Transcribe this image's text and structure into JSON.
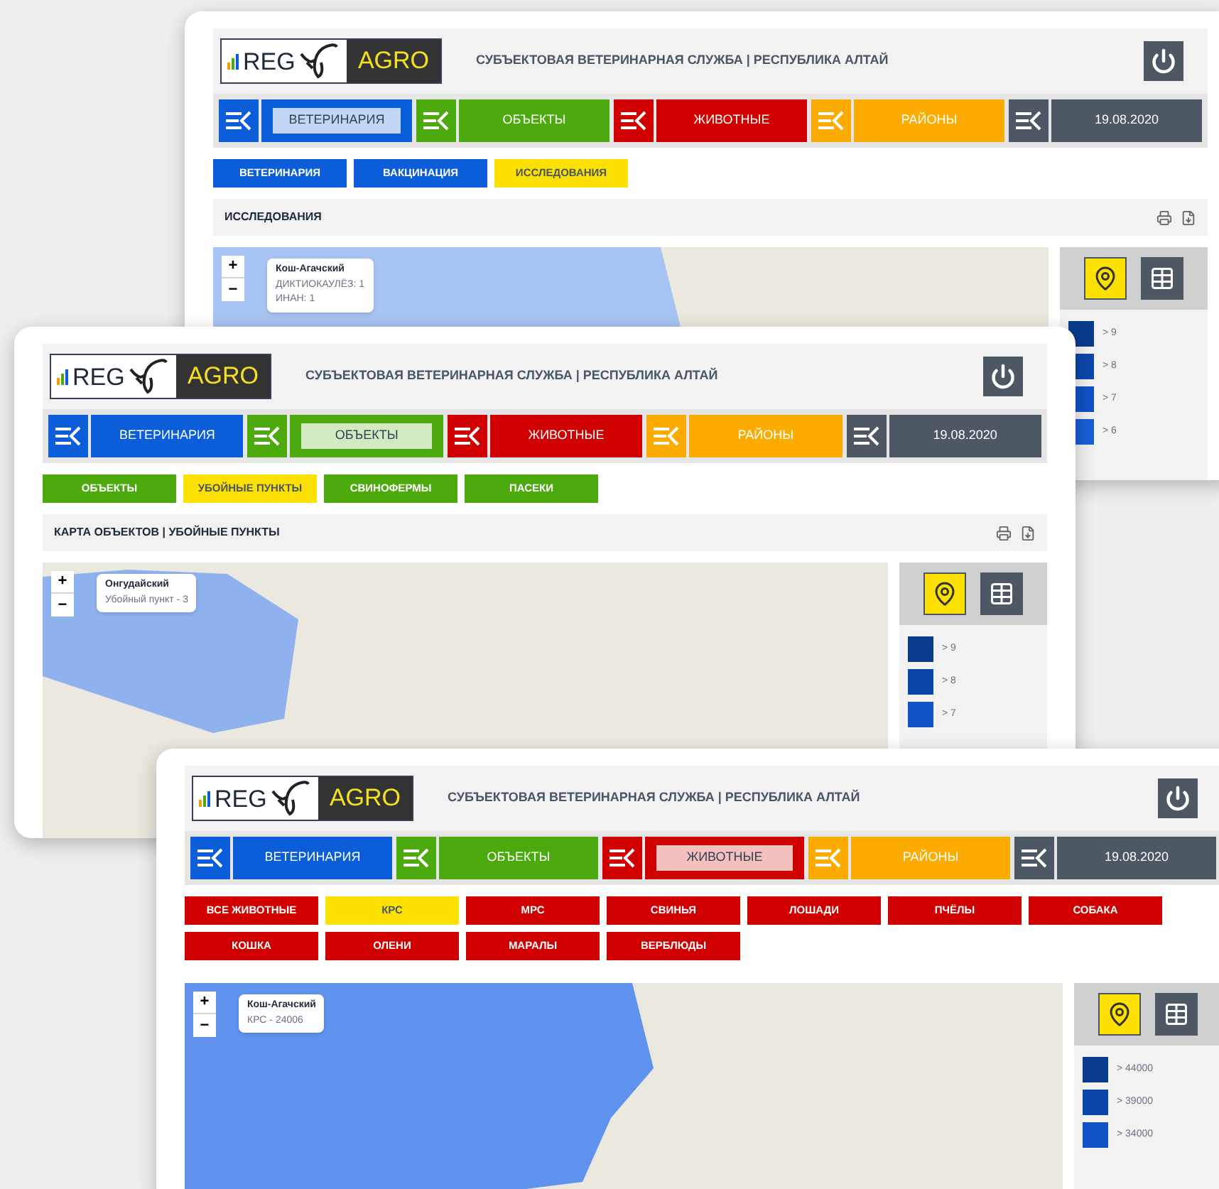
{
  "windows": [
    {
      "logo": {
        "brand": "REG",
        "product": "AGRO"
      },
      "title": "СУБЪЕКТОВАЯ ВЕТЕРИНАРНАЯ СЛУЖБА | РЕСПУБЛИКА АЛТАЙ",
      "nav": [
        {
          "label": "ВЕТЕРИНАРИЯ",
          "color": "#0b5ed7",
          "selected": true
        },
        {
          "label": "ОБЪЕКТЫ",
          "color": "#4caa0e",
          "selected": false
        },
        {
          "label": "ЖИВОТНЫЕ",
          "color": "#d00000",
          "selected": false
        },
        {
          "label": "РАЙОНЫ",
          "color": "#fcac00",
          "selected": false
        },
        {
          "label": "19.08.2020",
          "color": "#4d5864",
          "selected": false
        }
      ],
      "subtabs": [
        {
          "label": "ВЕТЕРИНАРИЯ",
          "selected": false
        },
        {
          "label": "ВАКЦИНАЦИЯ",
          "selected": false
        },
        {
          "label": "ИССЛЕДОВАНИЯ",
          "selected": true
        }
      ],
      "section_title": "ИССЛЕДОВАНИЯ",
      "zoom": {
        "in": "+",
        "out": "−"
      },
      "tooltip": {
        "title": "Кош-Агачский",
        "lines": [
          "ДИКТИОКАУЛЁЗ: 1",
          "ИНАН: 1"
        ]
      },
      "legend": [
        {
          "label": "> 9",
          "color": "#0a3a8c"
        },
        {
          "label": "> 8",
          "color": "#0c46aa"
        },
        {
          "label": "> 7",
          "color": "#1152c4"
        },
        {
          "label": "> 6",
          "color": "#1a5ed6"
        }
      ]
    },
    {
      "logo": {
        "brand": "REG",
        "product": "AGRO"
      },
      "title": "СУБЪЕКТОВАЯ ВЕТЕРИНАРНАЯ СЛУЖБА | РЕСПУБЛИКА АЛТАЙ",
      "nav": [
        {
          "label": "ВЕТЕРИНАРИЯ",
          "color": "#0b5ed7",
          "selected": false
        },
        {
          "label": "ОБЪЕКТЫ",
          "color": "#4caa0e",
          "selected": true
        },
        {
          "label": "ЖИВОТНЫЕ",
          "color": "#d00000",
          "selected": false
        },
        {
          "label": "РАЙОНЫ",
          "color": "#fcac00",
          "selected": false
        },
        {
          "label": "19.08.2020",
          "color": "#4d5864",
          "selected": false
        }
      ],
      "subtabs": [
        {
          "label": "ОБЪЕКТЫ",
          "selected": false
        },
        {
          "label": "УБОЙНЫЕ ПУНКТЫ",
          "selected": true
        },
        {
          "label": "СВИНОФЕРМЫ",
          "selected": false
        },
        {
          "label": "ПАСЕКИ",
          "selected": false
        }
      ],
      "section_title": "КАРТА ОБЪЕКТОВ | УБОЙНЫЕ ПУНКТЫ",
      "zoom": {
        "in": "+",
        "out": "−"
      },
      "tooltip": {
        "title": "Онгудайский",
        "lines": [
          "Убойный пункт - 3"
        ]
      },
      "legend": [
        {
          "label": "> 9",
          "color": "#0a3a8c"
        },
        {
          "label": "> 8",
          "color": "#0c46aa"
        },
        {
          "label": "> 7",
          "color": "#1152c4"
        }
      ]
    },
    {
      "logo": {
        "brand": "REG",
        "product": "AGRO"
      },
      "title": "СУБЪЕКТОВАЯ ВЕТЕРИНАРНАЯ СЛУЖБА | РЕСПУБЛИКА АЛТАЙ",
      "nav": [
        {
          "label": "ВЕТЕРИНАРИЯ",
          "color": "#0b5ed7",
          "selected": false
        },
        {
          "label": "ОБЪЕКТЫ",
          "color": "#4caa0e",
          "selected": false
        },
        {
          "label": "ЖИВОТНЫЕ",
          "color": "#d00000",
          "selected": true
        },
        {
          "label": "РАЙОНЫ",
          "color": "#fcac00",
          "selected": false
        },
        {
          "label": "19.08.2020",
          "color": "#4d5864",
          "selected": false
        }
      ],
      "subtabs": [
        {
          "label": "ВСЕ ЖИВОТНЫЕ",
          "selected": false
        },
        {
          "label": "КРС",
          "selected": true
        },
        {
          "label": "МРС",
          "selected": false
        },
        {
          "label": "СВИНЬЯ",
          "selected": false
        },
        {
          "label": "ЛОШАДИ",
          "selected": false
        },
        {
          "label": "ПЧЁЛЫ",
          "selected": false
        },
        {
          "label": "СОБАКА",
          "selected": false
        },
        {
          "label": "КОШКА",
          "selected": false
        },
        {
          "label": "ОЛЕНИ",
          "selected": false
        },
        {
          "label": "МАРАЛЫ",
          "selected": false
        },
        {
          "label": "ВЕРБЛЮДЫ",
          "selected": false
        }
      ],
      "zoom": {
        "in": "+",
        "out": "−"
      },
      "tooltip": {
        "title": "Кош-Агачский",
        "lines": [
          "КРС - 24006"
        ]
      },
      "legend": [
        {
          "label": "> 44000",
          "color": "#0a3a8c"
        },
        {
          "label": "> 39000",
          "color": "#0c46aa"
        },
        {
          "label": "> 34000",
          "color": "#1152c4"
        }
      ]
    }
  ]
}
